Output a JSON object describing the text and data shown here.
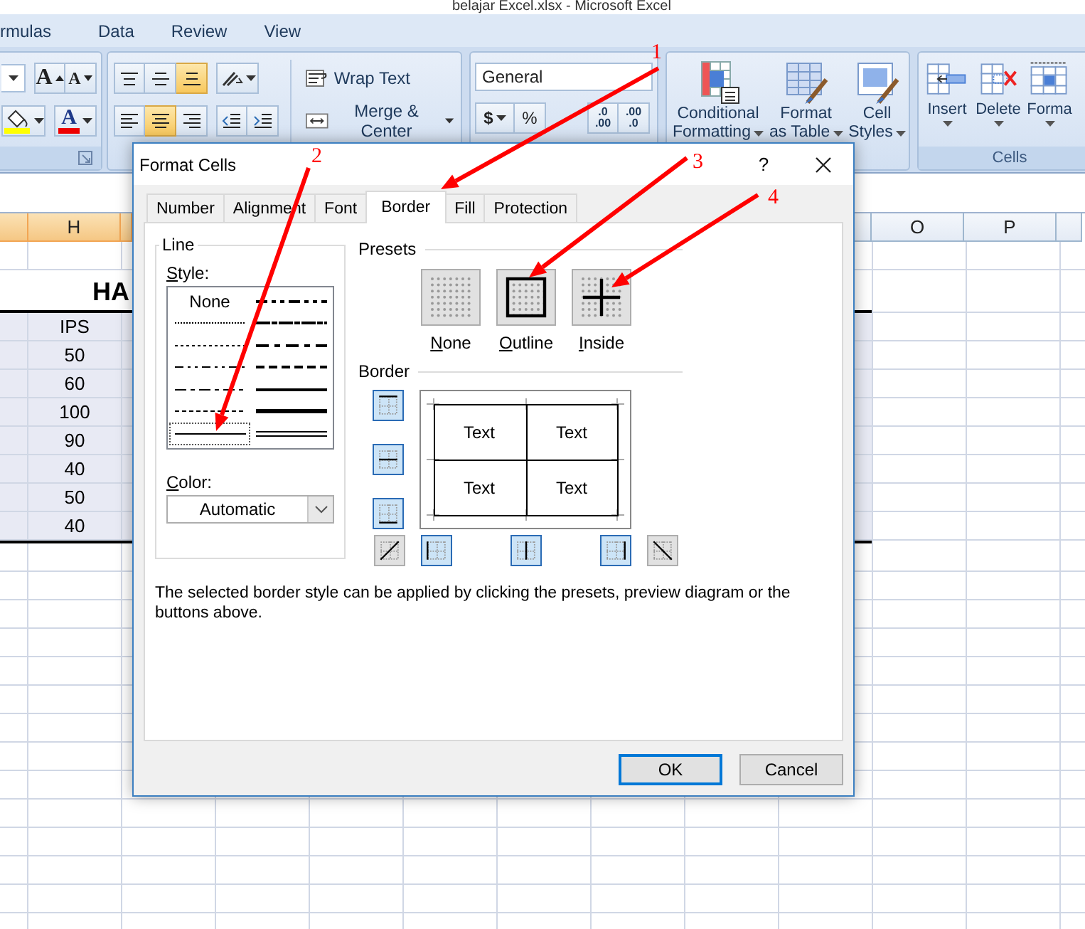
{
  "app_title": "belajar Excel.xlsx - Microsoft Excel",
  "ribbon": {
    "tabs": [
      {
        "label": "rmulas"
      },
      {
        "label": "Data"
      },
      {
        "label": "Review"
      },
      {
        "label": "View"
      }
    ],
    "font_group": {
      "grow_label": "A",
      "shrink_label": "A",
      "font_color_label": "A"
    },
    "alignment_group": {
      "vertical_align": [
        {
          "kind": "top",
          "selected": false
        },
        {
          "kind": "middle",
          "selected": false
        },
        {
          "kind": "bottom",
          "selected": true
        }
      ],
      "horizontal_align": [
        {
          "kind": "left",
          "selected": false
        },
        {
          "kind": "center",
          "selected": true
        },
        {
          "kind": "right",
          "selected": false
        }
      ],
      "wrap_text": "Wrap Text",
      "merge_center": "Merge & Center"
    },
    "number_group": {
      "format": "General",
      "currency": "$",
      "percent": "%",
      "decimal_buttons": [
        {
          "top": ".0",
          "bottom": ".00"
        },
        {
          "top": ".00",
          "bottom": ".0"
        }
      ]
    },
    "styles_group": {
      "buttons": [
        {
          "kind": "conditional",
          "lines": [
            "Conditional",
            "Formatting"
          ]
        },
        {
          "kind": "table",
          "lines": [
            "Format",
            "as Table"
          ]
        },
        {
          "kind": "cell",
          "lines": [
            "Cell",
            "Styles"
          ]
        }
      ]
    },
    "cells_group": {
      "label": "Cells",
      "buttons": [
        {
          "kind": "insert",
          "label": "Insert"
        },
        {
          "kind": "delete",
          "label": "Delete"
        },
        {
          "kind": "format",
          "label": "Forma"
        }
      ]
    }
  },
  "sheet": {
    "columns": [
      {
        "label": "H",
        "selected": true
      },
      {
        "label": "O",
        "selected": false
      },
      {
        "label": "P",
        "selected": false
      }
    ],
    "title_cell": "HA",
    "values": [
      "IPS",
      "50",
      "60",
      "100",
      "90",
      "40",
      "50",
      "40"
    ]
  },
  "dialog": {
    "title": "Format Cells",
    "help": "?",
    "tabs": [
      {
        "label": "Number",
        "selected": false
      },
      {
        "label": "Alignment",
        "selected": false
      },
      {
        "label": "Font",
        "selected": false
      },
      {
        "label": "Border",
        "selected": true
      },
      {
        "label": "Fill",
        "selected": false
      },
      {
        "label": "Protection",
        "selected": false
      }
    ],
    "line": {
      "heading": "Line",
      "style_label": "Style:",
      "styles": [
        {
          "kind": "none",
          "label": "None",
          "selected": false
        },
        {
          "kind": "hair",
          "selected": false
        },
        {
          "kind": "dotted",
          "selected": false
        },
        {
          "kind": "dash_dot_dot",
          "selected": false
        },
        {
          "kind": "dash_dot",
          "selected": false
        },
        {
          "kind": "dashed",
          "selected": false
        },
        {
          "kind": "thin",
          "selected": true
        },
        {
          "kind": "medium_dash_dot_dot",
          "selected": false
        },
        {
          "kind": "slant_dash_dot",
          "selected": false
        },
        {
          "kind": "medium_dash_dot",
          "selected": false
        },
        {
          "kind": "medium_dashed",
          "selected": false
        },
        {
          "kind": "medium",
          "selected": false
        },
        {
          "kind": "thick",
          "selected": false
        },
        {
          "kind": "double",
          "selected": false
        }
      ],
      "color_label": "Color:",
      "color_value": "Automatic"
    },
    "presets": {
      "heading": "Presets",
      "items": [
        {
          "kind": "none",
          "label": "None"
        },
        {
          "kind": "outline",
          "label": "Outline"
        },
        {
          "kind": "inside",
          "label": "Inside"
        }
      ]
    },
    "border": {
      "heading": "Border",
      "side_buttons": [
        {
          "kind": "top",
          "on": true
        },
        {
          "kind": "middle",
          "on": true
        },
        {
          "kind": "bottom",
          "on": true
        }
      ],
      "bottom_buttons": [
        {
          "kind": "diag_up",
          "on": false
        },
        {
          "kind": "left",
          "on": true
        },
        {
          "kind": "center",
          "on": true
        },
        {
          "kind": "right",
          "on": true
        },
        {
          "kind": "diag_down",
          "on": false
        }
      ],
      "preview_cells": [
        "Text",
        "Text",
        "Text",
        "Text"
      ]
    },
    "description": "The selected border style can be applied by clicking the presets, preview diagram or the buttons above.",
    "buttons": [
      {
        "label": "OK",
        "default": true
      },
      {
        "label": "Cancel",
        "default": false
      }
    ]
  },
  "annotations": [
    {
      "label": "1"
    },
    {
      "label": "2"
    },
    {
      "label": "3"
    },
    {
      "label": "4"
    }
  ]
}
